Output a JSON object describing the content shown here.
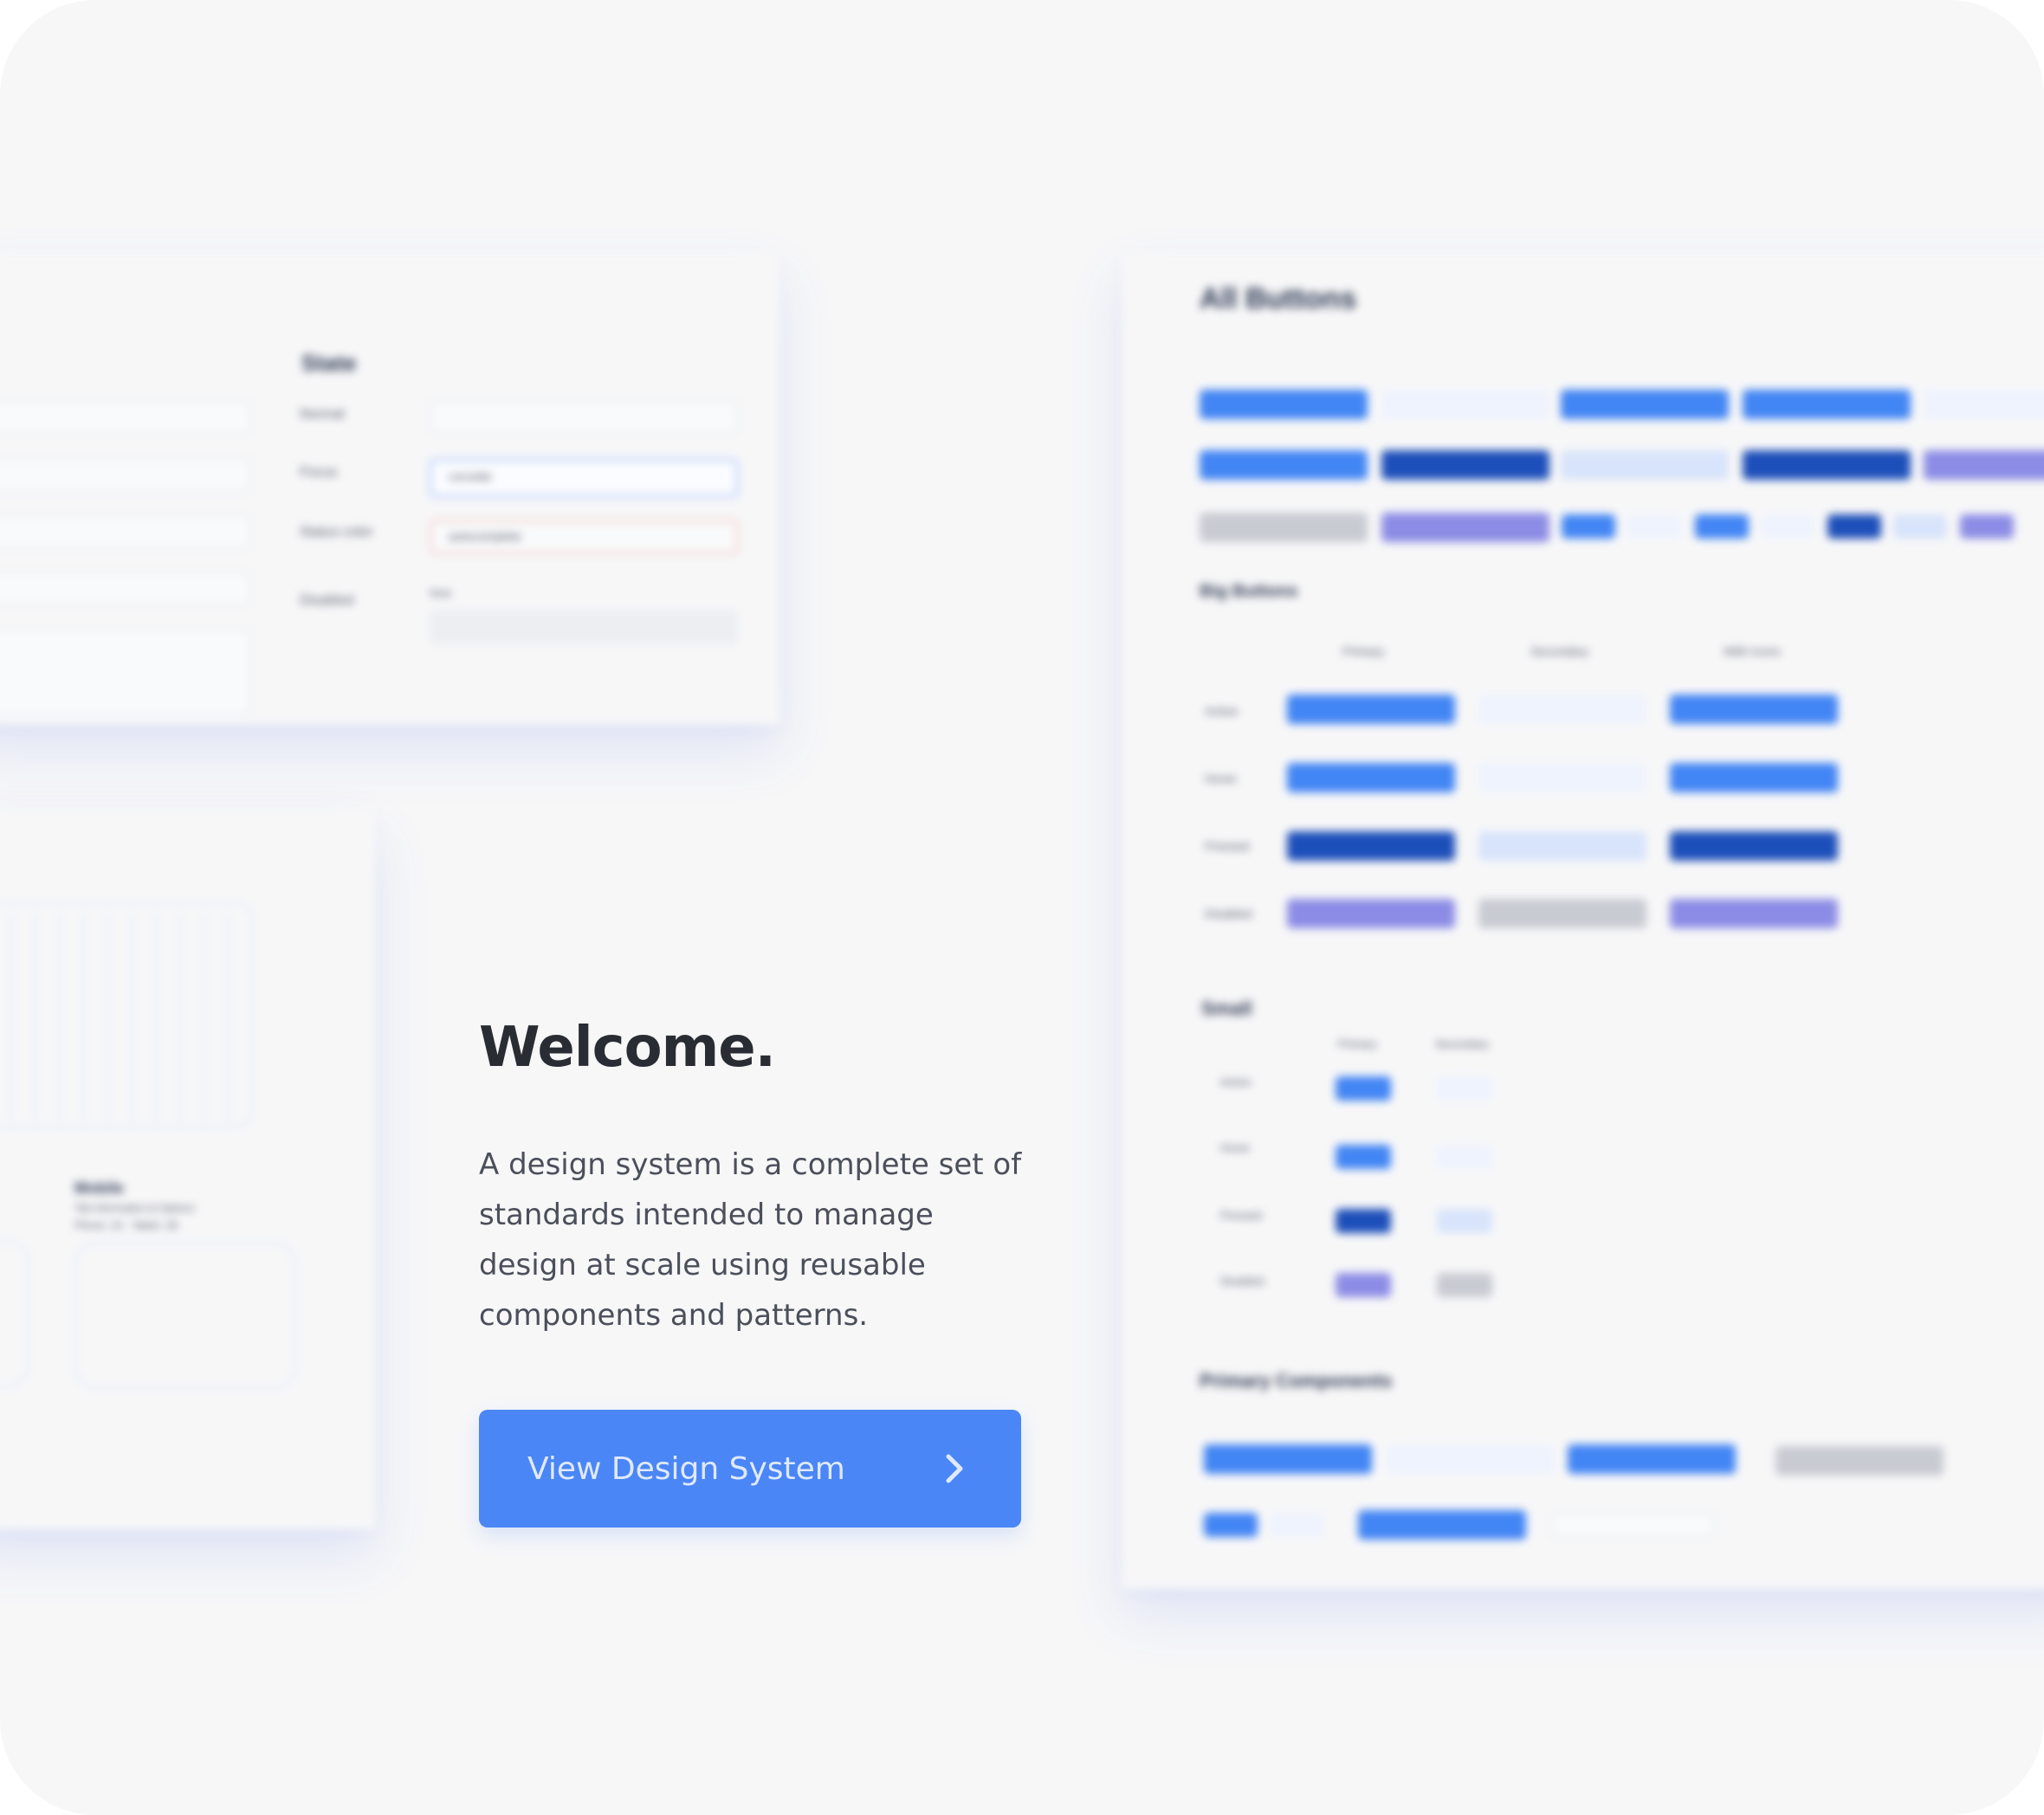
{
  "hero": {
    "title": "Welcome.",
    "description": "A design system is a complete set of standards intended to manage design at scale using reusable components and patterns.",
    "cta_label": "View Design System",
    "cta_icon": "chevron-right-icon"
  },
  "state_panel": {
    "title": "State",
    "rows": [
      "Normal",
      "Focus",
      "Status color",
      "Disabled"
    ],
    "focus_value": "corvette",
    "error_value": "autocomplete",
    "disabled_caption": "Note"
  },
  "mobile_panel": {
    "title": "Mobile",
    "subtitle": "Tab Information & Options",
    "meta": "Phone: 1A  ·  Tablet: 1B"
  },
  "buttons_panel": {
    "title": "All Buttons",
    "big_title": "Big Buttons",
    "big_columns": [
      "Primary",
      "Secondary",
      "With Icons"
    ],
    "big_rows": [
      "Active",
      "Hover",
      "Pressed",
      "Disabled"
    ],
    "small_title": "Small",
    "small_columns": [
      "Primary",
      "Secondary"
    ],
    "small_rows": [
      "Active",
      "Hover",
      "Pressed",
      "Disabled"
    ],
    "components_title": "Primary Components"
  },
  "colors": {
    "primary": "#4285f4",
    "primary_pressed": "#1d4fba",
    "secondary": "#eef3fd",
    "disabled_primary": "#8c8ce6",
    "disabled_secondary": "#c9cbd3",
    "background": "#f7f7f8"
  }
}
